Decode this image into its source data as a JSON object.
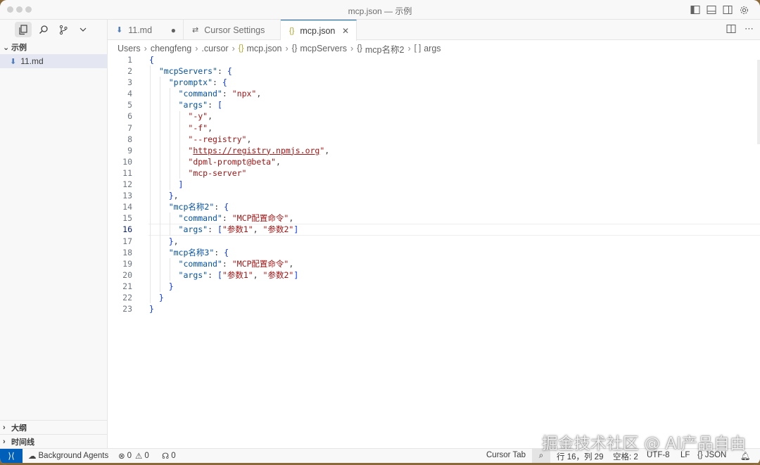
{
  "window": {
    "title": "mcp.json — 示例"
  },
  "sidebar": {
    "folder": "示例",
    "files": [
      {
        "name": "11.md"
      }
    ],
    "outline": "大纲",
    "timeline": "时间线"
  },
  "tabs": [
    {
      "label": "11.md",
      "icon": "markdown-icon",
      "modified": true
    },
    {
      "label": "Cursor Settings",
      "icon": "settings-icon"
    },
    {
      "label": "mcp.json",
      "icon": "json-braces-icon",
      "active": true
    }
  ],
  "breadcrumb": [
    "Users",
    "chengfeng",
    ".cursor",
    "mcp.json",
    "mcpServers",
    "mcp名称2",
    "args"
  ],
  "editor": {
    "current_line": 16,
    "lines": [
      "{",
      "  \"mcpServers\": {",
      "    \"promptx\": {",
      "      \"command\": \"npx\",",
      "      \"args\": [",
      "        \"-y\",",
      "        \"-f\",",
      "        \"--registry\",",
      "        \"https://registry.npmjs.org\",",
      "        \"dpml-prompt@beta\",",
      "        \"mcp-server\"",
      "      ]",
      "    },",
      "    \"mcp名称2\": {",
      "      \"command\": \"MCP配置命令\",",
      "      \"args\": [\"参数1\", \"参数2\"]",
      "    },",
      "    \"mcp名称3\": {",
      "      \"command\": \"MCP配置命令\",",
      "      \"args\": [\"参数1\", \"参数2\"]",
      "    }",
      "  }",
      "}"
    ]
  },
  "statusbar": {
    "background_agents": "Background Agents",
    "errors": "0",
    "warnings": "0",
    "ports": "0",
    "cursor_tab": "Cursor Tab",
    "position": "行 16，列 29",
    "spaces": "空格: 2",
    "encoding": "UTF-8",
    "eol": "LF",
    "language": "JSON"
  },
  "watermark": "掘金技术社区 @ AI产品自由",
  "colors": {
    "accent": "#005fb8",
    "string": "#a31515",
    "key": "#0451a5"
  }
}
